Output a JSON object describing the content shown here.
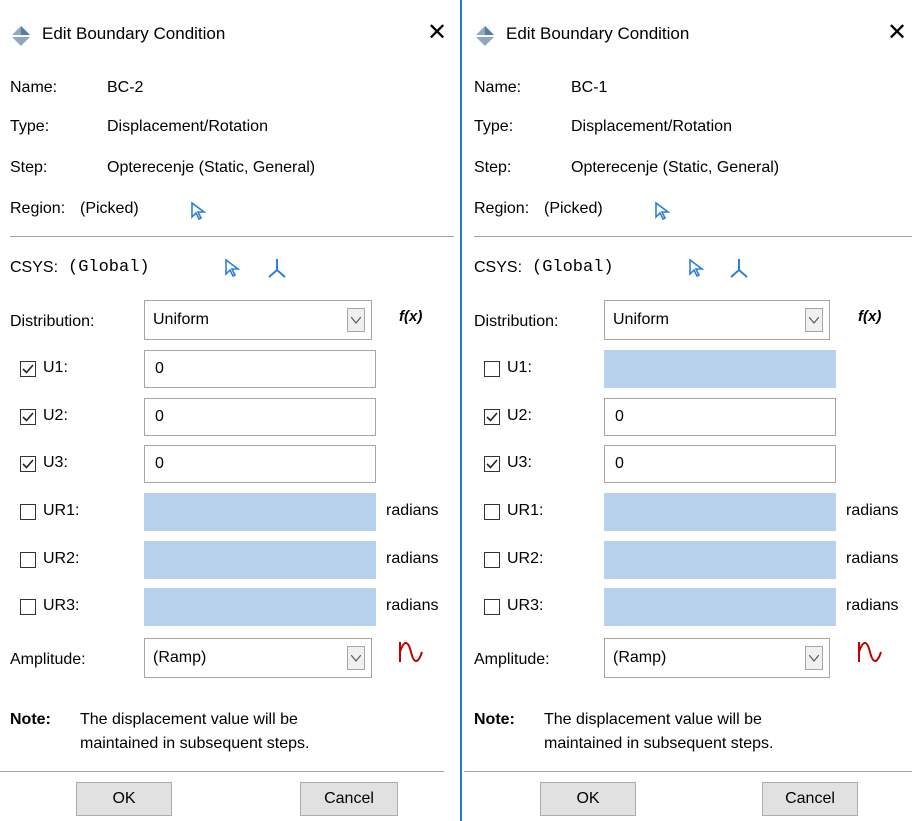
{
  "left": {
    "title": "Edit Boundary Condition",
    "close": "✕",
    "name_label": "Name:",
    "name_value": "BC-2",
    "type_label": "Type:",
    "type_value": "Displacement/Rotation",
    "step_label": "Step:",
    "step_value": "Opterecenje (Static, General)",
    "region_label": "Region:",
    "region_value": "(Picked)",
    "csys_label": "CSYS:",
    "csys_value": "(Global)",
    "distribution_label": "Distribution:",
    "distribution_value": "Uniform",
    "fx": "f(x)",
    "u1": {
      "label": "U1:",
      "checked": true,
      "value": "0"
    },
    "u2": {
      "label": "U2:",
      "checked": true,
      "value": "0"
    },
    "u3": {
      "label": "U3:",
      "checked": true,
      "value": "0"
    },
    "ur1": {
      "label": "UR1:",
      "checked": false,
      "value": "",
      "unit": "radians"
    },
    "ur2": {
      "label": "UR2:",
      "checked": false,
      "value": "",
      "unit": "radians"
    },
    "ur3": {
      "label": "UR3:",
      "checked": false,
      "value": "",
      "unit": "radians"
    },
    "amplitude_label": "Amplitude:",
    "amplitude_value": "(Ramp)",
    "note_label": "Note:",
    "note_line1": "The displacement value will be",
    "note_line2": "maintained in subsequent steps.",
    "ok": "OK",
    "cancel": "Cancel"
  },
  "right": {
    "title": "Edit Boundary Condition",
    "close": "✕",
    "name_label": "Name:",
    "name_value": "BC-1",
    "type_label": "Type:",
    "type_value": "Displacement/Rotation",
    "step_label": "Step:",
    "step_value": "Opterecenje (Static, General)",
    "region_label": "Region:",
    "region_value": "(Picked)",
    "csys_label": "CSYS:",
    "csys_value": "(Global)",
    "distribution_label": "Distribution:",
    "distribution_value": "Uniform",
    "fx": "f(x)",
    "u1": {
      "label": "U1:",
      "checked": false,
      "value": ""
    },
    "u2": {
      "label": "U2:",
      "checked": true,
      "value": "0"
    },
    "u3": {
      "label": "U3:",
      "checked": true,
      "value": "0"
    },
    "ur1": {
      "label": "UR1:",
      "checked": false,
      "value": "",
      "unit": "radians"
    },
    "ur2": {
      "label": "UR2:",
      "checked": false,
      "value": "",
      "unit": "radians"
    },
    "ur3": {
      "label": "UR3:",
      "checked": false,
      "value": "",
      "unit": "radians"
    },
    "amplitude_label": "Amplitude:",
    "amplitude_value": "(Ramp)",
    "note_label": "Note:",
    "note_line1": "The displacement value will be",
    "note_line2": "maintained in subsequent steps.",
    "ok": "OK",
    "cancel": "Cancel"
  },
  "colors": {
    "accent_border": "#2b79d6",
    "disabled_field": "#b7d1ed",
    "pick_arrow": "#2f7fd8",
    "amplitude_icon": "#c00000"
  },
  "icons": {
    "title": "abaqus-diamond-icon",
    "pick": "pick-arrow-icon",
    "csys": "csys-axes-icon",
    "amplitude": "amplitude-wave-icon"
  }
}
